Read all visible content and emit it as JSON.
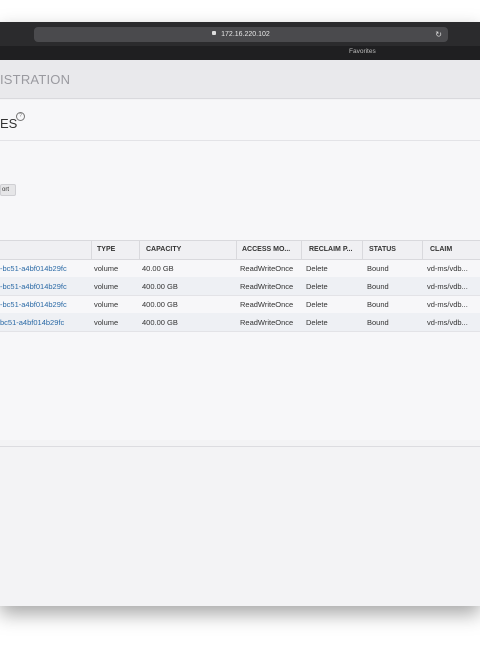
{
  "browser": {
    "url": "172.16.220.102",
    "favorites_label": "Favorites"
  },
  "app": {
    "title": "ISTRATION"
  },
  "page": {
    "title": "ES",
    "help_icon": "?"
  },
  "toolbar": {
    "export_label": "ort"
  },
  "table": {
    "columns": [
      "",
      "TYPE",
      "CAPACITY",
      "ACCESS MO...",
      "RECLAIM P...",
      "STATUS",
      "CLAIM"
    ],
    "rows": [
      [
        "-bc51-a4bf014b29fc",
        "volume",
        "40.00 GB",
        "ReadWriteOnce",
        "Delete",
        "Bound",
        "vd-ms/vdb..."
      ],
      [
        "-bc51-a4bf014b29fc",
        "volume",
        "400.00 GB",
        "ReadWriteOnce",
        "Delete",
        "Bound",
        "vd-ms/vdb..."
      ],
      [
        "-bc51-a4bf014b29fc",
        "volume",
        "400.00 GB",
        "ReadWriteOnce",
        "Delete",
        "Bound",
        "vd-ms/vdb..."
      ],
      [
        "bc51-a4bf014b29fc",
        "volume",
        "400.00 GB",
        "ReadWriteOnce",
        "Delete",
        "Bound",
        "vd-ms/vdb..."
      ]
    ]
  },
  "icons": {
    "lock": "lock-icon",
    "reload": "reload-icon",
    "help": "help-icon"
  },
  "colors": {
    "link": "#2b6aa6",
    "header_bg": "#e9e9ec"
  }
}
